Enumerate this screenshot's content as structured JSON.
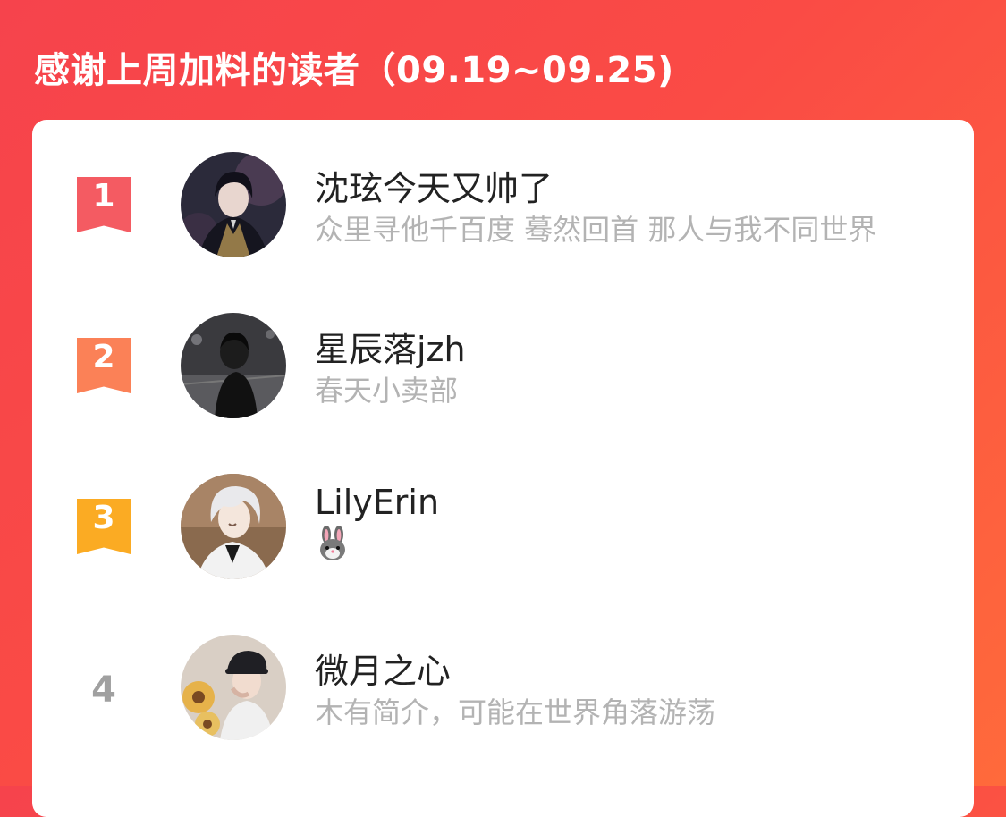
{
  "header": {
    "title": "感谢上周加料的读者（09.19~09.25)"
  },
  "colors": {
    "background_start": "#f6434c",
    "background_end": "#ff6a3b",
    "rank1": "#f45b62",
    "rank2": "#fb8157",
    "rank3": "#fbab23",
    "name_text": "#222222",
    "bio_text": "#b3b3b3"
  },
  "readers": [
    {
      "rank": "1",
      "name": "沈玹今天又帅了",
      "bio": "众里寻他千百度 蓦然回首 那人与我不同世界",
      "avatar_icon": "avatar-dark-haired-anime-man"
    },
    {
      "rank": "2",
      "name": "星辰落jzh",
      "bio": "春天小卖部",
      "avatar_icon": "avatar-night-street-person"
    },
    {
      "rank": "3",
      "name": "LilyErin",
      "bio": "🐰",
      "avatar_icon": "avatar-white-haired-anime-man"
    },
    {
      "rank": "4",
      "name": "微月之心",
      "bio": "木有简介，可能在世界角落游荡",
      "avatar_icon": "avatar-girl-with-flowers"
    }
  ]
}
